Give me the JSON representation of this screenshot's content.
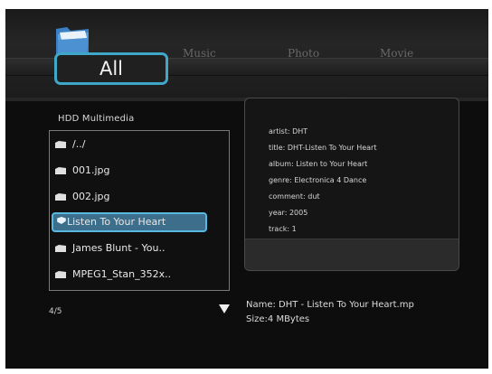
{
  "tabs": {
    "all": "All",
    "music": "Music",
    "photo": "Photo",
    "movie": "Movie"
  },
  "browser": {
    "location": "HDD  Multimedia",
    "items": [
      {
        "label": "/../",
        "icon": "folder-icon"
      },
      {
        "label": "001.jpg",
        "icon": "file-icon"
      },
      {
        "label": "002.jpg",
        "icon": "file-icon"
      },
      {
        "label": "Listen To Your Heart",
        "icon": "music-file-icon",
        "selected": true
      },
      {
        "label": "James Blunt - You..",
        "icon": "file-icon"
      },
      {
        "label": "MPEG1_Stan_352x..",
        "icon": "file-icon"
      }
    ],
    "page": "4/5"
  },
  "details": {
    "artist": "artist: DHT",
    "title": "title: DHT-Listen To Your Heart",
    "album": "album: Listen to Your Heart",
    "genre": "genre: Electronica 4 Dance",
    "comment": "comment: dut",
    "year": "year: 2005",
    "track": "track: 1",
    "name": "Name: DHT - Listen To Your Heart.mp",
    "size": "Size:4 MBytes"
  },
  "colors": {
    "accent": "#3fa7c8",
    "selection": "#3d6f8c",
    "background": "#0d0d0d"
  }
}
